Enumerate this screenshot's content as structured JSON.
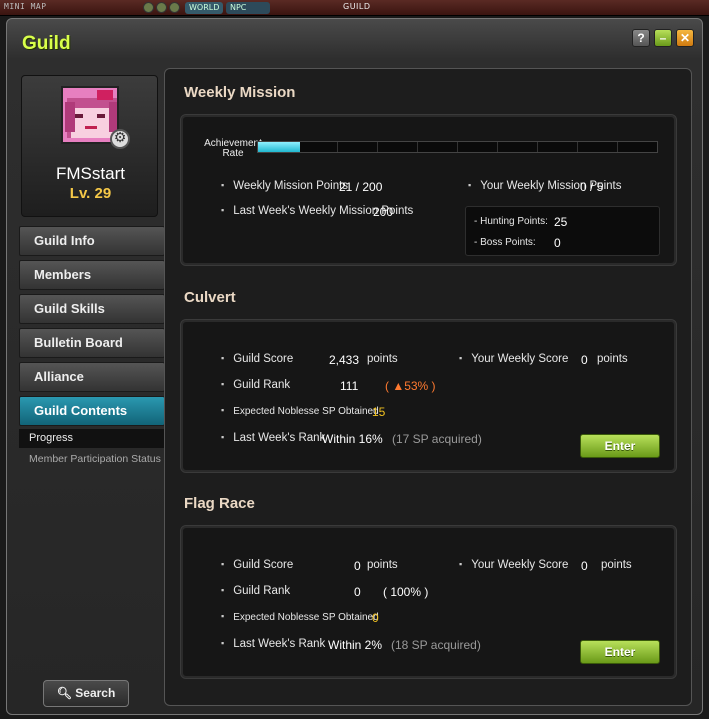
{
  "topbar": {
    "minimap": "MINI MAP",
    "world": "WORLD",
    "npc": "NPC",
    "guild_tab": "GUILD"
  },
  "window": {
    "title": "Guild",
    "help": "?",
    "minimize": "–",
    "close": "✕"
  },
  "profile": {
    "name": "FMSstart",
    "level": "Lv. 29"
  },
  "nav": {
    "items": [
      "Guild Info",
      "Members",
      "Guild Skills",
      "Bulletin Board",
      "Alliance",
      "Guild Contents"
    ],
    "sub_progress": "Progress",
    "sub_member": "Member Participation Status"
  },
  "search_button": "Search",
  "weekly": {
    "title": "Weekly Mission",
    "rate_label": "Achievement Rate",
    "rate_fraction": 0.105,
    "mission_points_label": "Weekly Mission Points",
    "mission_points_value": "21 / 200",
    "last_week_label": "Last Week's Weekly Mission Points",
    "last_week_value": "200",
    "your_points_label": "Your Weekly Mission Points",
    "your_points_value": "0 / 5",
    "hunting_label": "- Hunting Points:",
    "hunting_value": "25",
    "boss_label": "- Boss Points:",
    "boss_value": "0"
  },
  "culvert": {
    "title": "Culvert",
    "score_label": "Guild Score",
    "score_value": "2,433",
    "score_unit": "points",
    "your_score_label": "Your Weekly Score",
    "your_score_value": "0",
    "your_score_unit": "points",
    "rank_label": "Guild Rank",
    "rank_value": "111",
    "rank_pct": "( ▲53% )",
    "sp_label": "Expected Noblesse SP Obtained",
    "sp_value": "15",
    "last_rank_label": "Last Week's Rank",
    "last_rank_value": "Within 16%",
    "last_rank_sp": "(17 SP acquired)",
    "enter": "Enter"
  },
  "flag": {
    "title": "Flag Race",
    "score_label": "Guild Score",
    "score_value": "0",
    "score_unit": "points",
    "your_score_label": "Your Weekly Score",
    "your_score_value": "0",
    "your_score_unit": "points",
    "rank_label": "Guild Rank",
    "rank_value": "0",
    "rank_pct": "( 100% )",
    "sp_label": "Expected Noblesse SP Obtained",
    "sp_value": "0",
    "last_rank_label": "Last Week's Rank",
    "last_rank_value": "Within 2%",
    "last_rank_sp": "(18 SP acquired)",
    "enter": "Enter"
  }
}
